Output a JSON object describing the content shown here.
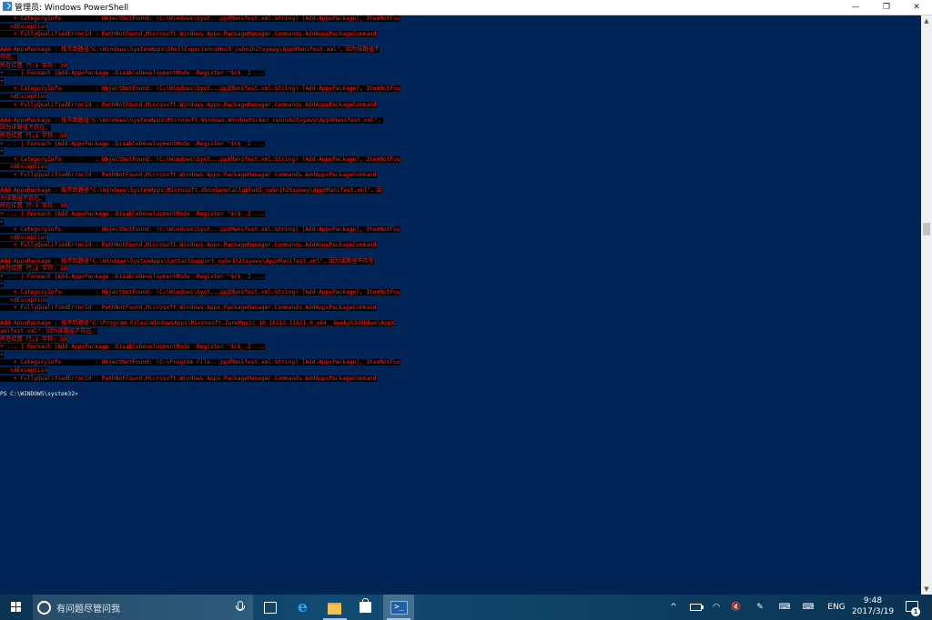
{
  "window": {
    "title": "管理员: Windows PowerShell",
    "minimize_glyph": "—",
    "restore_glyph": "❐",
    "close_glyph": "✕"
  },
  "console": {
    "lines": [
      {
        "text": "    + CategoryInfo          : ObjectNotFound: (C:\\Windows\\Syst...ppXManifest.xml:String) [Add-AppxPackage], ItemNotFou",
        "kind": "err"
      },
      {
        "text": "   ndException",
        "kind": "err"
      },
      {
        "text": "    + FullyQualifiedErrorId : PathNotFound,Microsoft.Windows.Appx.PackageManager.Commands.AddAppxPackageCommand",
        "kind": "err"
      },
      {
        "text": "",
        "kind": "blank"
      },
      {
        "text": "Add-AppxPackage : 找不到路径\"C:\\Windows\\SystemApps\\ShellExperienceHost_cw5n1h2txyewy\\AppXManifest.xml\"，因为该路径不",
        "kind": "err"
      },
      {
        "text": "存在。",
        "kind": "err"
      },
      {
        "text": "所在位置 行:1 字符: 39",
        "kind": "err"
      },
      {
        "text": "+ ... | Foreach {Add-AppxPackage -DisableDevelopmentMode -Register \"$($_.I ...",
        "kind": "err"
      },
      {
        "text": "+",
        "kind": "err"
      },
      {
        "text": "    + CategoryInfo          : ObjectNotFound: (C:\\Windows\\Syst...ppXManifest.xml:String) [Add-AppxPackage], ItemNotFou",
        "kind": "err"
      },
      {
        "text": "   ndException",
        "kind": "err"
      },
      {
        "text": "    + FullyQualifiedErrorId : PathNotFound,Microsoft.Windows.Appx.PackageManager.Commands.AddAppxPackageCommand",
        "kind": "err"
      },
      {
        "text": "",
        "kind": "blank"
      },
      {
        "text": "Add-AppxPackage : 找不到路径\"C:\\Windows\\SystemApps\\Microsoft.Windows.WindowPicker_cw5n1h2txyewy\\AppXManifest.xml\"，",
        "kind": "err"
      },
      {
        "text": "因为该路径不存在。",
        "kind": "err"
      },
      {
        "text": "所在位置 行:1 字符: 39",
        "kind": "err"
      },
      {
        "text": "+ ... | Foreach {Add-AppxPackage -DisableDevelopmentMode -Register \"$($_.I ...",
        "kind": "err"
      },
      {
        "text": "+",
        "kind": "err"
      },
      {
        "text": "    + CategoryInfo          : ObjectNotFound: (C:\\Windows\\Syst...ppXManifest.xml:String) [Add-AppxPackage], ItemNotFou",
        "kind": "err"
      },
      {
        "text": "   ndException",
        "kind": "err"
      },
      {
        "text": "    + FullyQualifiedErrorId : PathNotFound,Microsoft.Windows.Appx.PackageManager.Commands.AddAppxPackageCommand",
        "kind": "err"
      },
      {
        "text": "",
        "kind": "blank"
      },
      {
        "text": "Add-AppxPackage : 找不到路径\"C:\\Windows\\SystemApps\\Microsoft.XboxGameCallableUI_cw5n1h2txyewy\\AppXManifest.xml\"，因",
        "kind": "err"
      },
      {
        "text": "为该路径不存在。",
        "kind": "err"
      },
      {
        "text": "所在位置 行:1 字符: 39",
        "kind": "err"
      },
      {
        "text": "+ ... | Foreach {Add-AppxPackage -DisableDevelopmentMode -Register \"$($_.I ...",
        "kind": "err"
      },
      {
        "text": "+",
        "kind": "err"
      },
      {
        "text": "    + CategoryInfo          : ObjectNotFound: (C:\\Windows\\Syst...ppXManifest.xml:String) [Add-AppxPackage], ItemNotFou",
        "kind": "err"
      },
      {
        "text": "   ndException",
        "kind": "err"
      },
      {
        "text": "    + FullyQualifiedErrorId : PathNotFound,Microsoft.Windows.Appx.PackageManager.Commands.AddAppxPackageCommand",
        "kind": "err"
      },
      {
        "text": "",
        "kind": "blank"
      },
      {
        "text": "Add-AppxPackage : 找不到路径\"C:\\Windows\\SystemApps\\ContactSupport_cw5n1h2txyewy\\AppXManifest.xml\"，因为该路径不存在",
        "kind": "err"
      },
      {
        "text": "所在位置 行:1 字符: 39",
        "kind": "err"
      },
      {
        "text": "+ ... | Foreach {Add-AppxPackage -DisableDevelopmentMode -Register \"$($_.I ...",
        "kind": "err"
      },
      {
        "text": "+",
        "kind": "err"
      },
      {
        "text": "    + CategoryInfo          : ObjectNotFound: (C:\\Windows\\Syst...ppXManifest.xml:String) [Add-AppxPackage], ItemNotFou",
        "kind": "err"
      },
      {
        "text": "   ndException",
        "kind": "err"
      },
      {
        "text": "    + FullyQualifiedErrorId : PathNotFound,Microsoft.Windows.Appx.PackageManager.Commands.AddAppxPackageCommand",
        "kind": "err"
      },
      {
        "text": "",
        "kind": "blank"
      },
      {
        "text": "Add-AppxPackage : 找不到路径\"C:\\Program Files\\WindowsApps\\Microsoft.ZuneMusic_10.16112.11621.0_x64__8wekyb3d8bbwe\\AppX",
        "kind": "err"
      },
      {
        "text": "anifest.xml\"，因为该路径不存在。",
        "kind": "err"
      },
      {
        "text": "所在位置 行:1 字符: 39",
        "kind": "err"
      },
      {
        "text": "+ ... | Foreach {Add-AppxPackage -DisableDevelopmentMode -Register \"$($_.I ...",
        "kind": "err"
      },
      {
        "text": "+",
        "kind": "err"
      },
      {
        "text": "    + CategoryInfo          : ObjectNotFound: (C:\\Program File...ppXManifest.xml:String) [Add-AppxPackage], ItemNotFou",
        "kind": "err"
      },
      {
        "text": "   ndException",
        "kind": "err"
      },
      {
        "text": "    + FullyQualifiedErrorId : PathNotFound,Microsoft.Windows.Appx.PackageManager.Commands.AddAppxPackageCommand",
        "kind": "err"
      },
      {
        "text": "",
        "kind": "blank"
      },
      {
        "text": "PS C:\\WINDOWS\\system32>",
        "kind": "prompt"
      }
    ]
  },
  "scrollbar": {
    "up_glyph": "▲",
    "down_glyph": "▼"
  },
  "taskbar": {
    "search_placeholder": "有问题尽管问我",
    "apps": [
      {
        "name": "task-view-button",
        "icon": "task-view-icon"
      },
      {
        "name": "edge-button",
        "icon": "edge-icon",
        "glyph": "e"
      },
      {
        "name": "file-explorer-button",
        "icon": "folder-icon"
      },
      {
        "name": "store-button",
        "icon": "store-icon"
      },
      {
        "name": "powershell-button",
        "icon": "powershell-icon",
        "glyph": ">_",
        "active": true
      }
    ],
    "tray": {
      "chevron_glyph": "^",
      "wifi_glyph": "◠",
      "volume_glyph": "🔇",
      "pen_glyph": "✎",
      "keyboard_glyph": "⌨",
      "language": "ENG",
      "time": "9:48",
      "date": "2017/3/19",
      "notification_count": "1"
    }
  }
}
